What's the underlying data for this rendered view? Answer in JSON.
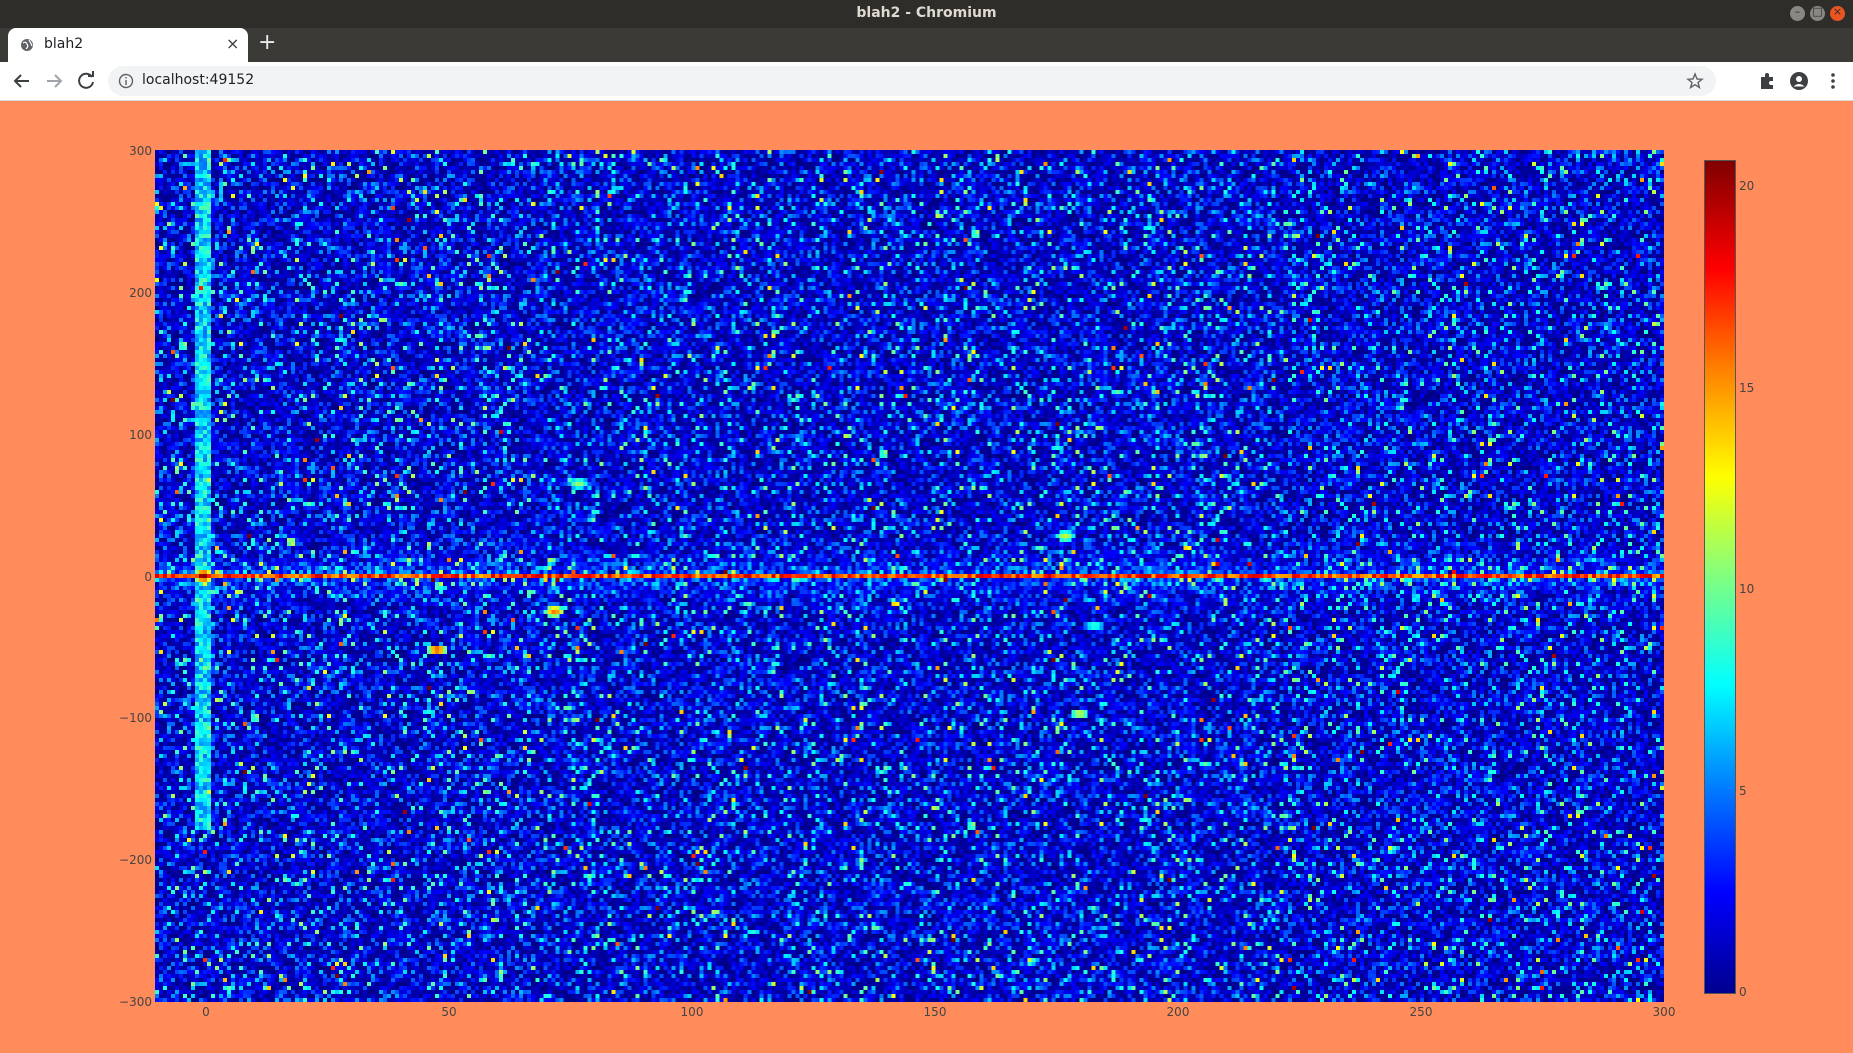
{
  "window": {
    "title": "blah2 - Chromium"
  },
  "tab": {
    "title": "blah2",
    "close": "×",
    "new_tab": "+"
  },
  "toolbar": {
    "url": "localhost:49152"
  },
  "chart_data": {
    "type": "heatmap",
    "title": "",
    "xlabel": "",
    "ylabel": "",
    "x_range": [
      -10,
      300
    ],
    "y_range": [
      -300,
      300
    ],
    "x_ticks": [
      "0",
      "50",
      "100",
      "150",
      "200",
      "250",
      "300"
    ],
    "y_ticks": [
      "300",
      "200",
      "100",
      "0",
      "−100",
      "−200",
      "−300"
    ],
    "colorscale": "jet",
    "z_range": [
      0,
      21
    ],
    "colorbar_ticks": [
      "20",
      "15",
      "10",
      "5",
      "0"
    ],
    "background_level": 3,
    "features": [
      {
        "kind": "horizontal_ridge",
        "y": 0,
        "x_from": -10,
        "x_to": 300,
        "value": 17
      },
      {
        "kind": "vertical_ridge",
        "x": 0,
        "y_from": -180,
        "y_to": 300,
        "value": 8
      },
      {
        "kind": "hotspot",
        "x": 0,
        "y": 0,
        "value": 21
      },
      {
        "kind": "hotspot",
        "x": 77,
        "y": 65,
        "value": 11
      },
      {
        "kind": "hotspot",
        "x": 72,
        "y": -25,
        "value": 16
      },
      {
        "kind": "hotspot",
        "x": 48,
        "y": -52,
        "value": 17
      },
      {
        "kind": "hotspot",
        "x": 180,
        "y": -97,
        "value": 12
      },
      {
        "kind": "hotspot",
        "x": 183,
        "y": -35,
        "value": 9
      },
      {
        "kind": "hotspot",
        "x": 177,
        "y": 28,
        "value": 12
      }
    ]
  }
}
